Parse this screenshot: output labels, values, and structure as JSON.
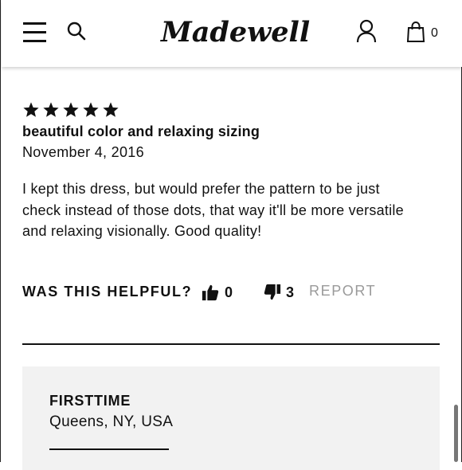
{
  "header": {
    "logo_text": "Madewell",
    "bag_count": "0"
  },
  "review": {
    "rating": 5,
    "title": "beautiful color and relaxing sizing",
    "date": "November 4, 2016",
    "body_lines": [
      "I kept this dress, but would prefer the pattern to be just",
      "check instead of those dots, that way it'll be more versatile",
      "and relaxing visionally. Good quality!"
    ],
    "helpful_label": "WAS THIS HELPFUL?",
    "helpful_up": "0",
    "helpful_down": "3",
    "report_label": "REPORT"
  },
  "next_review": {
    "reviewer_name": "FIRSTTIME",
    "reviewer_location": "Queens, NY, USA"
  },
  "icons": {
    "menu": "hamburger-icon",
    "search": "search-icon",
    "account": "account-icon",
    "bag": "shopping-bag-icon",
    "star": "star-icon",
    "thumbs_up": "thumbs-up-icon",
    "thumbs_down": "thumbs-down-icon"
  },
  "colors": {
    "text": "#111111",
    "muted": "#9a9a9a",
    "card_bg": "#f2f2f2"
  }
}
